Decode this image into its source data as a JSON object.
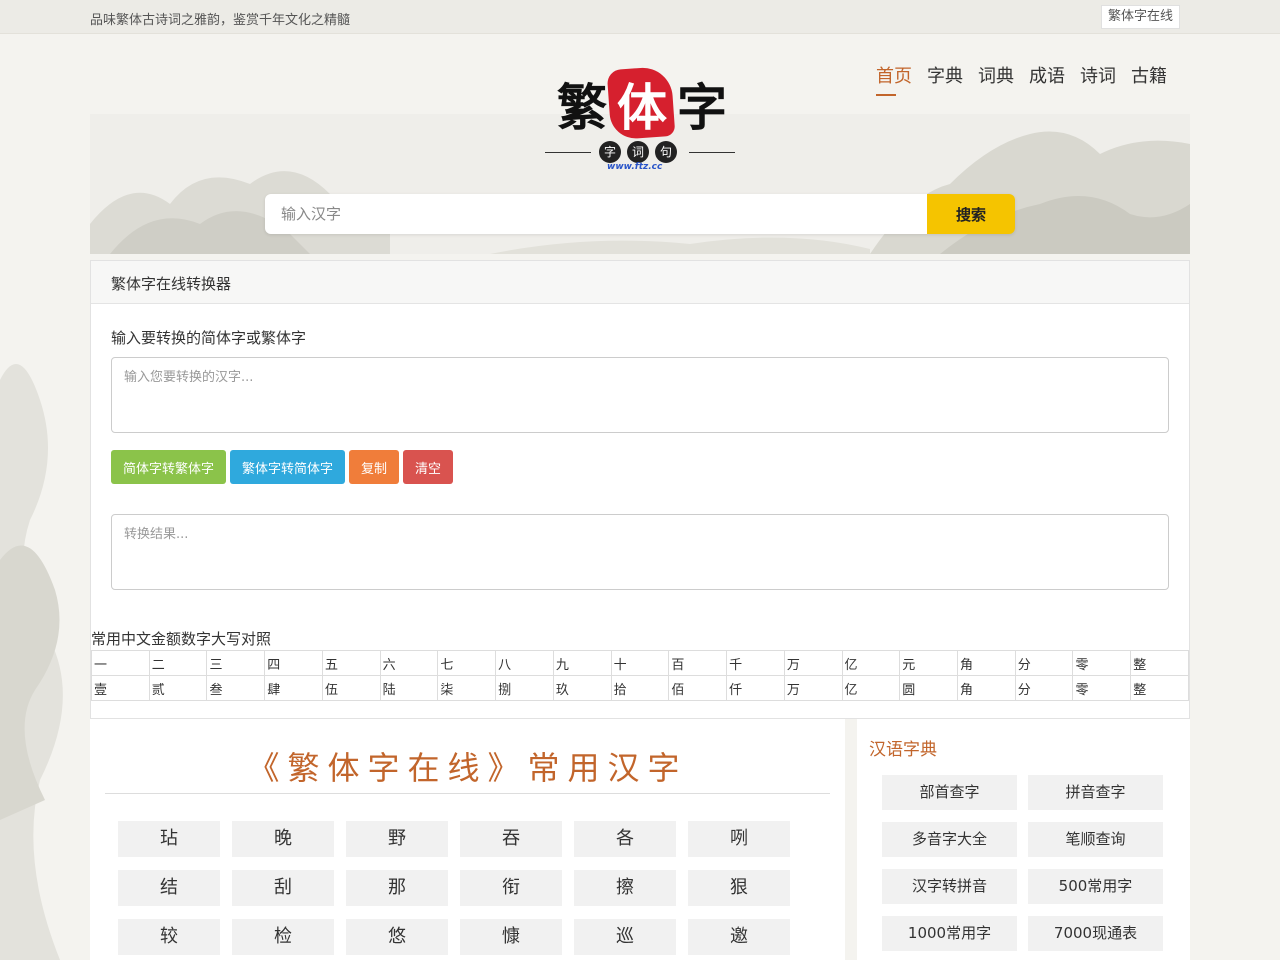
{
  "topbar": {
    "slogan": "品味繁体古诗词之雅韵，鉴赏千年文化之精髓",
    "right_link": "繁体字在线"
  },
  "logo": {
    "chars": [
      "繁",
      "体",
      "字"
    ],
    "sub": [
      "字",
      "词",
      "句"
    ],
    "url": "www.ftz.cc"
  },
  "nav": [
    "首页",
    "字典",
    "词典",
    "成语",
    "诗词",
    "古籍"
  ],
  "search": {
    "placeholder": "输入汉字",
    "button": "搜索"
  },
  "converter": {
    "header": "繁体字在线转换器",
    "label": "输入要转换的简体字或繁体字",
    "input_placeholder": "输入您要转换的汉字...",
    "output_placeholder": "转换结果...",
    "buttons": [
      "简体字转繁体字",
      "繁体字转简体字",
      "复制",
      "清空"
    ]
  },
  "numerals": {
    "title": "常用中文金额数字大写对照",
    "lower": [
      "一",
      "二",
      "三",
      "四",
      "五",
      "六",
      "七",
      "八",
      "九",
      "十",
      "百",
      "千",
      "万",
      "亿",
      "元",
      "角",
      "分",
      "零",
      "整"
    ],
    "upper": [
      "壹",
      "贰",
      "叁",
      "肆",
      "伍",
      "陆",
      "柒",
      "捌",
      "玖",
      "拾",
      "佰",
      "仟",
      "万",
      "亿",
      "圆",
      "角",
      "分",
      "零",
      "整"
    ]
  },
  "common": {
    "title": "《繁体字在线》常用汉字",
    "chars": [
      "玷",
      "晚",
      "野",
      "吞",
      "各",
      "咧",
      "结",
      "刮",
      "那",
      "衔",
      "擦",
      "狠",
      "较",
      "检",
      "悠",
      "慷",
      "巡",
      "邀"
    ]
  },
  "dictionary": {
    "title": "汉语字典",
    "links": [
      "部首查字",
      "拼音查字",
      "多音字大全",
      "笔顺查询",
      "汉字转拼音",
      "500常用字",
      "1000常用字",
      "7000现通表"
    ]
  },
  "colors": {
    "accent": "#c2652b",
    "search_button": "#f5c400",
    "seal": "#d6202e",
    "green": "#8bc34a",
    "blue": "#2fa9dd",
    "orange": "#f07d3a",
    "red": "#d9534f"
  }
}
